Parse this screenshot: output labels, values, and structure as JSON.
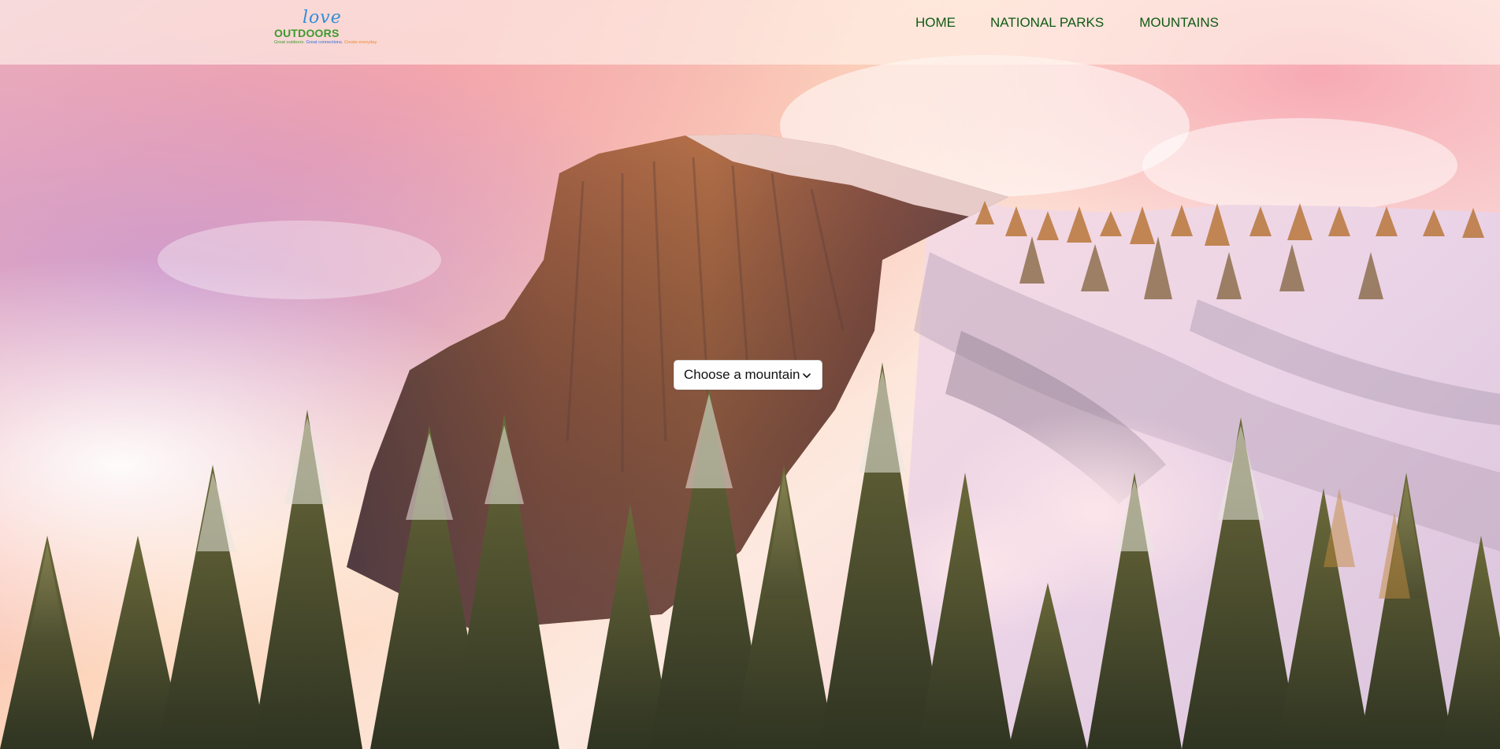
{
  "header": {
    "logo": {
      "script": "love",
      "word": "OUTDOORS",
      "tagline_parts": [
        "Great outdoors.",
        "Great connections.",
        "Create everyday."
      ],
      "icon": "love-outdoors-logo"
    },
    "nav": [
      {
        "label": "HOME"
      },
      {
        "label": "NATIONAL PARKS"
      },
      {
        "label": "MOUNTAINS"
      }
    ]
  },
  "hero": {
    "background": "snowy-granite-mountain-dome-with-pine-trees-at-sunrise",
    "select": {
      "value": "Choose a mountain",
      "icon": "chevron-down-icon"
    }
  },
  "colors": {
    "nav_text": "#0f5a14",
    "header_bg": "#fff5ee",
    "logo_green": "#3c9a2e",
    "logo_blue": "#2f8fd8",
    "logo_orange": "#e98a2a"
  }
}
